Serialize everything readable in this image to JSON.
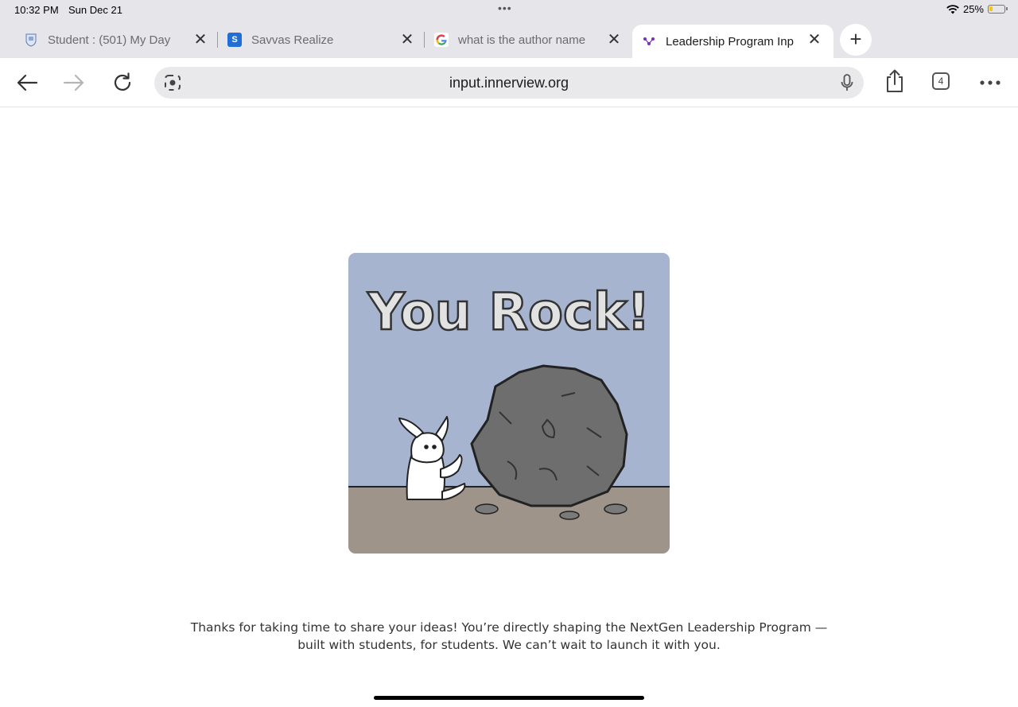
{
  "status_bar": {
    "time": "10:32 PM",
    "date": "Sun Dec 21",
    "battery_percent": "25%",
    "battery_level": 0.25
  },
  "tabs": [
    {
      "title": "Student : (501) My Day",
      "icon": "school-crest-icon",
      "active": false
    },
    {
      "title": "Savvas Realize",
      "icon": "savvas-logo-icon",
      "active": false
    },
    {
      "title": "what is the author name",
      "icon": "google-logo-icon",
      "active": false
    },
    {
      "title": "Leadership Program Inp",
      "icon": "innerview-logo-icon",
      "active": true
    }
  ],
  "toolbar": {
    "url": "input.innerview.org",
    "tab_count": "4"
  },
  "main": {
    "image_text": "You Rock!",
    "message_line1": "Thanks for taking  time to share your ideas! You’re directly shaping the NextGen Leadership Program —",
    "message_line2": "built with students, for students. We can’t wait to launch it with you."
  },
  "colors": {
    "chrome_bg": "#e5e5ea",
    "address_bg": "#e9e9ec",
    "illustration_sky": "#a6b4d0",
    "illustration_ground": "#9f948a",
    "rock": "#6e6e6e"
  }
}
